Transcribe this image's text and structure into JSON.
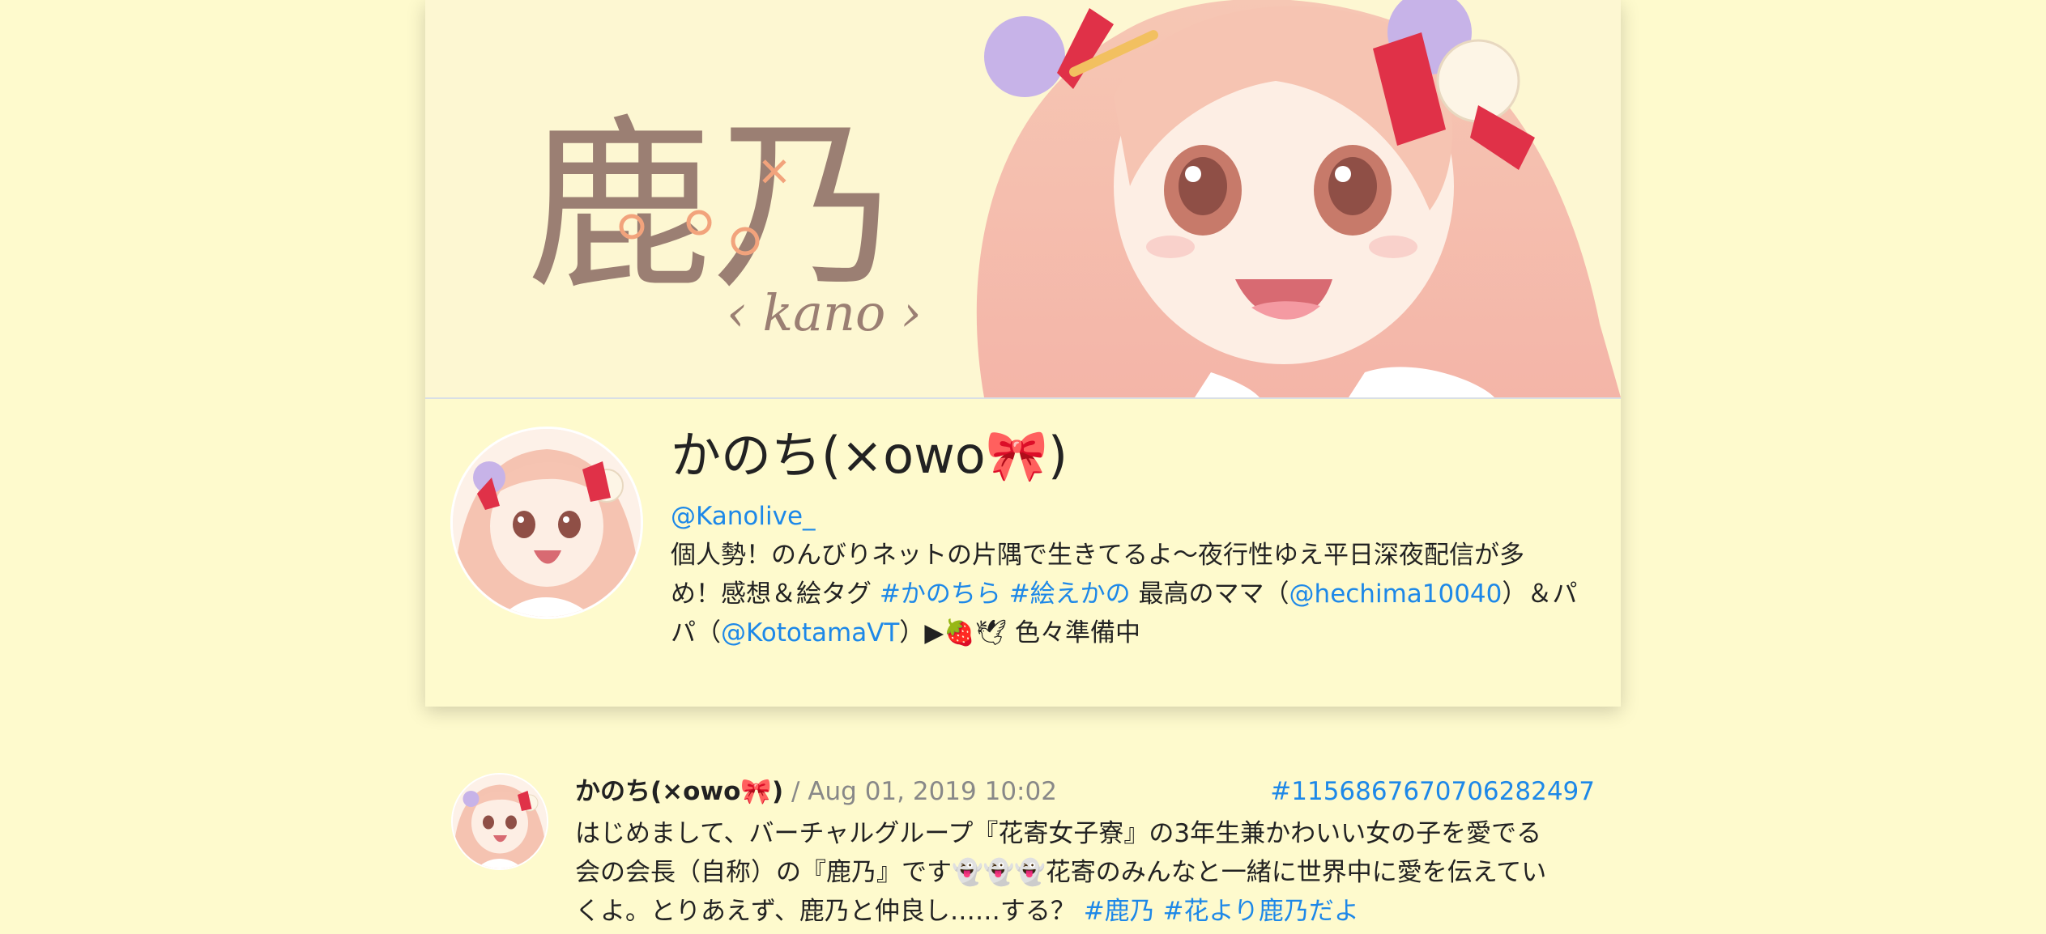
{
  "profile": {
    "display_name": "かのち(×owo🎀)",
    "handle": "@Kanolive_",
    "logo_text": "鹿乃",
    "logo_sub": "‹ kano ›",
    "bio": {
      "line1": "個人勢！のんびりネットの片隅で生きてるよ〜夜行性ゆえ平日深夜配信が多",
      "line2_a": "め！感想＆絵タグ ",
      "tag1": "#かのちら",
      "tag2": "#絵えかの",
      "line2_b": " 最高のママ（",
      "mention1": "@hechima10040",
      "line2_c": "）＆パ",
      "line3_a": "パ（",
      "mention2": "@KototamaVT",
      "line3_b": "）▶🍓🕊 色々準備中"
    }
  },
  "post": {
    "author": "かのち(×owo🎀)",
    "date": " / Aug 01, 2019 10:02",
    "id": "#1156867670706282497",
    "text_line1": "はじめまして、バーチャルグループ『花寄女子寮』の3年生兼かわいい女の子を愛でる",
    "text_line2": "会の会長（自称）の『鹿乃』です👻👻👻花寄のみんなと一緒に世界中に愛を伝えてい",
    "text_line3": "くよ。とりあえず、鹿乃と仲良し……する？ ",
    "tag1": "#鹿乃",
    "tag2": "#花より鹿乃だよ"
  },
  "colors": {
    "background": "#fefacd",
    "link": "#1d88e8",
    "text": "#222222",
    "muted": "#888888"
  }
}
